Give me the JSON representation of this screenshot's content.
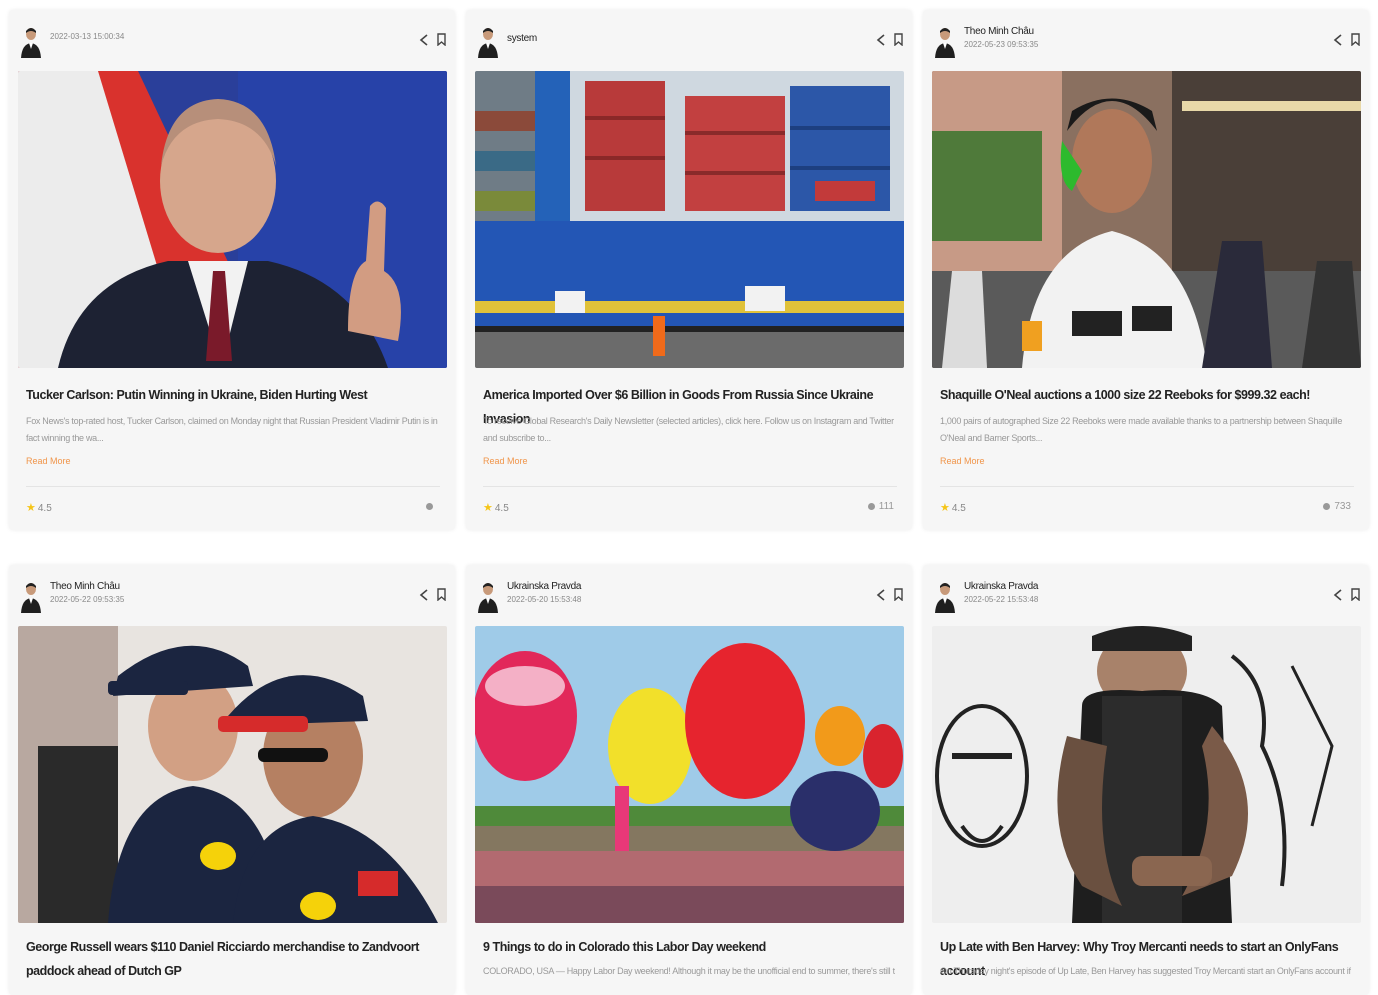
{
  "cards": [
    {
      "author": "",
      "date": "2022-03-13 15:00:34",
      "title": "Tucker Carlson: Putin Winning in Ukraine, Biden Hurting West",
      "excerpt": "Fox News's top-rated host, Tucker Carlson, claimed on Monday night that Russian President Vladimir Putin is in fact winning the wa...",
      "read_more": "Read More",
      "rating": "4.5",
      "views": ""
    },
    {
      "author": "system",
      "date": "",
      "title": "America Imported Over $6 Billion in Goods From Russia Since Ukraine Invasion",
      "excerpt": "To receive Global Research's Daily Newsletter (selected articles), click here. Follow us on Instagram and Twitter and subscribe to...",
      "read_more": "Read More",
      "rating": "4.5",
      "views": "111"
    },
    {
      "author": "Theo Minh Châu",
      "date": "2022-05-23 09:53:35",
      "title": "Shaquille O'Neal auctions a 1000 size 22 Reeboks for $999.32 each!",
      "excerpt": "1,000 pairs of autographed Size 22 Reeboks were made available thanks to a partnership between Shaquille O'Neal and Barner Sports...",
      "read_more": "Read More",
      "rating": "4.5",
      "views": "733"
    },
    {
      "author": "Theo Minh Châu",
      "date": "2022-05-22 09:53:35",
      "title": "George Russell wears $110 Daniel Ricciardo merchandise to Zandvoort paddock ahead of Dutch GP",
      "excerpt": "",
      "read_more": "",
      "rating": "",
      "views": ""
    },
    {
      "author": "Ukrainska Pravda",
      "date": "2022-05-20 15:53:48",
      "title": "9 Things to do in Colorado this Labor Day weekend",
      "excerpt": "COLORADO, USA — Happy Labor Day weekend! Although it may be the unofficial end to summer, there's still time to",
      "read_more": "",
      "rating": "",
      "views": ""
    },
    {
      "author": "Ukrainska Pravda",
      "date": "2022-05-22 15:53:48",
      "title": "Up Late with Ben Harvey: Why Troy Mercanti needs to start an OnlyFans account",
      "excerpt": "On Thursday night's episode of Up Late, Ben Harvey has suggested Troy Mercanti start an OnlyFans account if he",
      "read_more": "",
      "rating": "",
      "views": ""
    }
  ],
  "colors": {
    "accent": "#f0954a",
    "star": "#f5c518",
    "card_bg": "#f6f6f6"
  },
  "icons": [
    "avatar",
    "share-icon",
    "bookmark-icon",
    "star-icon",
    "eye-icon"
  ]
}
